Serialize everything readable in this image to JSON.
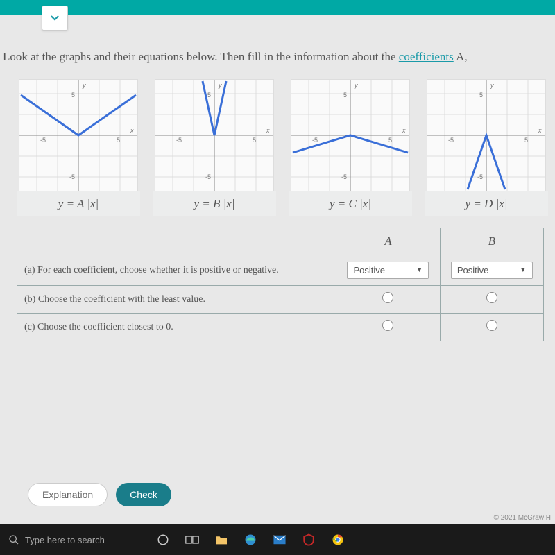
{
  "instruction_prefix": "Look at the graphs and their equations below. Then fill in the information about the ",
  "instruction_link": "coefficients",
  "instruction_suffix": " A,",
  "equations": {
    "A": "y = A |x|",
    "B": "y = B |x|",
    "C": "y = C |x|",
    "D": "y = D |x|"
  },
  "chart_data": [
    {
      "type": "line",
      "title": "",
      "xlabel": "x",
      "ylabel": "y",
      "xlim": [
        -7,
        7
      ],
      "ylim": [
        -7,
        7
      ],
      "series": [
        {
          "name": "y=A|x|",
          "x": [
            -7,
            0,
            7
          ],
          "y": [
            4.9,
            0,
            4.9
          ]
        }
      ],
      "note": "opens up, wide (|A| ≈ 0.7)"
    },
    {
      "type": "line",
      "title": "",
      "xlabel": "x",
      "ylabel": "y",
      "xlim": [
        -7,
        7
      ],
      "ylim": [
        -7,
        7
      ],
      "series": [
        {
          "name": "y=B|x|",
          "x": [
            -2,
            0,
            2
          ],
          "y": [
            7,
            0,
            7
          ]
        }
      ],
      "note": "opens up, very narrow (|B| ≈ 3.5)"
    },
    {
      "type": "line",
      "title": "",
      "xlabel": "x",
      "ylabel": "y",
      "xlim": [
        -7,
        7
      ],
      "ylim": [
        -7,
        7
      ],
      "series": [
        {
          "name": "y=C|x|",
          "x": [
            -7,
            0,
            7
          ],
          "y": [
            -2.1,
            0,
            -2.1
          ]
        }
      ],
      "note": "opens down, very wide (C ≈ -0.3)"
    },
    {
      "type": "line",
      "title": "",
      "xlabel": "x",
      "ylabel": "y",
      "xlim": [
        -7,
        7
      ],
      "ylim": [
        -7,
        7
      ],
      "series": [
        {
          "name": "y=D|x|",
          "x": [
            -3,
            0,
            3
          ],
          "y": [
            -7,
            0,
            -7
          ]
        }
      ],
      "note": "opens down, narrow (D ≈ -2.3)"
    }
  ],
  "table": {
    "headers": {
      "A": "A",
      "B": "B"
    },
    "rows": {
      "a": "(a) For each coefficient, choose whether it is positive or negative.",
      "b": "(b) Choose the coefficient with the least value.",
      "c": "(c) Choose the coefficient closest to 0."
    },
    "selected": {
      "A": "Positive",
      "B": "Positive"
    }
  },
  "buttons": {
    "explanation": "Explanation",
    "check": "Check"
  },
  "copyright": "© 2021 McGraw H",
  "taskbar": {
    "search": "Type here to search"
  }
}
